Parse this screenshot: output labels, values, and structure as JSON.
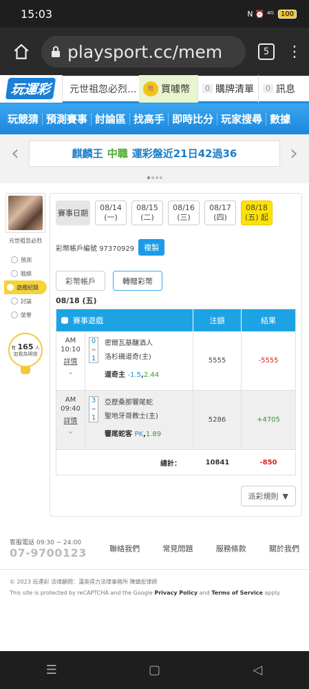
{
  "status": {
    "time": "15:03",
    "icons": "N ⏰ ⁴ᴳ",
    "battery": "100"
  },
  "browser": {
    "url": "playsport.cc/mem",
    "tabs_count": "5"
  },
  "topbar": {
    "logo": "玩運彩",
    "user": "元世祖忽必烈...",
    "coin_label": "買噱幣",
    "coin_icon": "幣",
    "cart_count": "0",
    "cart_label": "購牌清單",
    "msg_count": "0",
    "msg_label": "訊息"
  },
  "nav": [
    "玩競猜",
    "預測賽事",
    "討論區",
    "找高手",
    "即時比分",
    "玩家搜尋",
    "數據"
  ],
  "promo": {
    "part1": "麒麟王",
    "part2": "中職",
    "part3": "運彩盤近21日42過36"
  },
  "sidebar": {
    "name": "元世祖忽必烈",
    "links": [
      {
        "label": "預測",
        "icon": "◎"
      },
      {
        "label": "戰績",
        "icon": "◎"
      },
      {
        "label": "遊戲紀錄",
        "icon": "◎"
      },
      {
        "label": "討論",
        "icon": "◎"
      },
      {
        "label": "榮譽",
        "icon": "◎"
      }
    ],
    "likes_prefix": "有",
    "likes_count": "165",
    "likes_suffix": "人",
    "likes_text": "加我為明燈"
  },
  "dates": {
    "label": "賽事日期",
    "items": [
      {
        "date": "08/14",
        "day": "(一)"
      },
      {
        "date": "08/15",
        "day": "(二)"
      },
      {
        "date": "08/16",
        "day": "(三)"
      },
      {
        "date": "08/17",
        "day": "(四)"
      },
      {
        "date": "08/18",
        "day": "(五) 起"
      }
    ]
  },
  "account": {
    "label": "彩幣帳戶編號 97370929",
    "copy": "複製"
  },
  "tabs": {
    "coin_account": "彩幣帳戶",
    "transfer": "轉贈彩幣"
  },
  "date_heading": "08/18 (五)",
  "table": {
    "headers": {
      "game": "賽事遊戲",
      "amount": "注額",
      "result": "結果"
    },
    "rows": [
      {
        "ampm": "AM",
        "time": "10:10",
        "detail": "詳情",
        "score_away": "0",
        "score_home": "1",
        "vs": "vs",
        "away": "密爾瓦基釀酒人",
        "home": "洛杉磯道奇(主)",
        "pick": "道奇主",
        "handicap": "-1.5",
        "odds": "2.44",
        "amount": "5555",
        "result": "-5555"
      },
      {
        "ampm": "AM",
        "time": "09:40",
        "detail": "詳情",
        "score_away": "3",
        "score_home": "1",
        "vs": "vs",
        "away": "亞歷桑那響尾蛇",
        "home": "聖地牙哥教士(主)",
        "pick": "響尾蛇客",
        "handicap": "PK",
        "odds": "1.89",
        "amount": "5286",
        "result": "+4705"
      }
    ],
    "total_label": "總計：",
    "total_amount": "10841",
    "total_result": "-850"
  },
  "rules_button": "派彩規則",
  "footer": {
    "hotline_label": "客服電話 09:30 ~ 24:00",
    "hotline": "07-9700123",
    "links": [
      "聯絡我們",
      "常見問題",
      "服務條款",
      "關於我們"
    ],
    "copyright": "© 2023 玩運彩 法律顧問：漢英得力法律事務所 陳鎮宏律師",
    "recaptcha_prefix": "This site is protected by reCAPTCHA and the Google",
    "privacy": "Privacy Policy",
    "and": "and",
    "terms": "Terms of Service",
    "apply": "apply."
  },
  "sysnav": {
    "recent": "☰",
    "home": "▢",
    "back": "◁"
  }
}
